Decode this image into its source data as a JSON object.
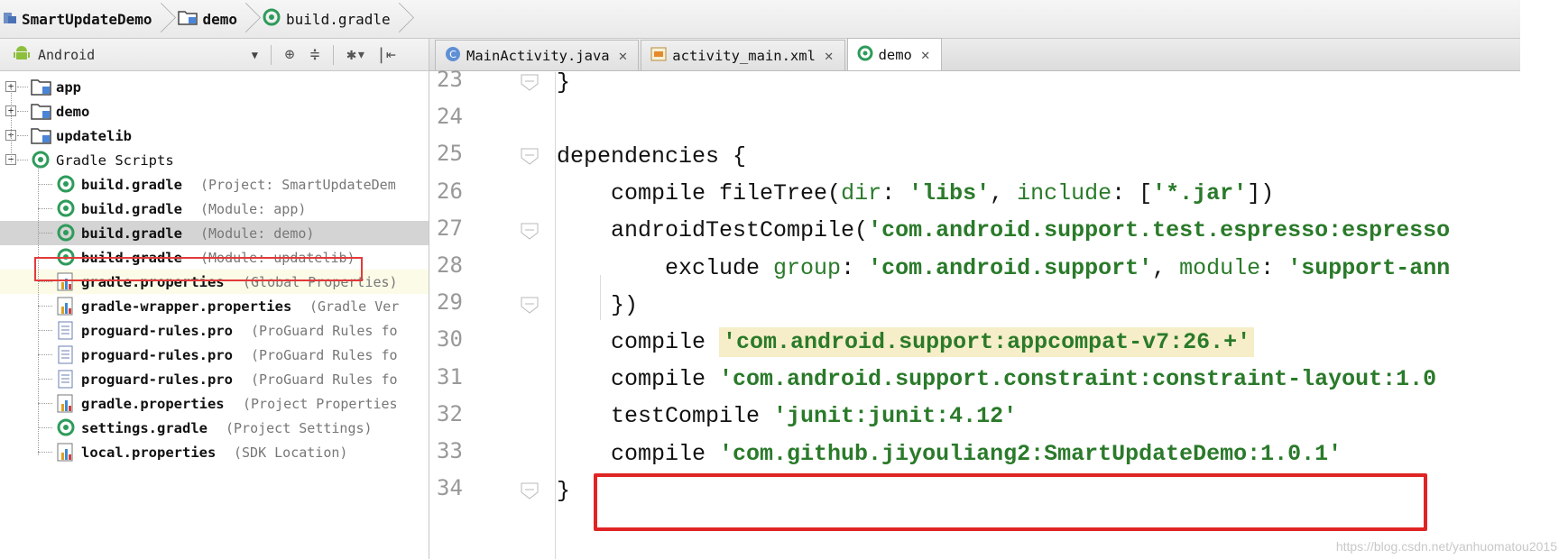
{
  "breadcrumb": [
    {
      "label": "SmartUpdateDemo",
      "icon": "project-module-icon"
    },
    {
      "label": "demo",
      "icon": "folder-module-icon"
    },
    {
      "label": "build.gradle",
      "icon": "gradle-icon"
    }
  ],
  "project_panel": {
    "view_mode": "Android",
    "tree": [
      {
        "label": "app",
        "hint": "",
        "type": "module",
        "bold": true
      },
      {
        "label": "demo",
        "hint": "",
        "type": "module",
        "bold": true
      },
      {
        "label": "updatelib",
        "hint": "",
        "type": "module",
        "bold": true
      },
      {
        "label": "Gradle Scripts",
        "hint": "",
        "type": "gradle-root",
        "bold": false
      },
      {
        "label": "build.gradle",
        "hint": "(Project: SmartUpdateDem",
        "type": "gradle"
      },
      {
        "label": "build.gradle",
        "hint": "(Module: app)",
        "type": "gradle"
      },
      {
        "label": "build.gradle",
        "hint": "(Module: demo)",
        "type": "gradle"
      },
      {
        "label": "build.gradle",
        "hint": "(Module: updatelib)",
        "type": "gradle"
      },
      {
        "label": "gradle.properties",
        "hint": "(Global Properties)",
        "type": "properties"
      },
      {
        "label": "gradle-wrapper.properties",
        "hint": "(Gradle Ver",
        "type": "properties"
      },
      {
        "label": "proguard-rules.pro",
        "hint": "(ProGuard Rules fo",
        "type": "text"
      },
      {
        "label": "proguard-rules.pro",
        "hint": "(ProGuard Rules fo",
        "type": "text"
      },
      {
        "label": "proguard-rules.pro",
        "hint": "(ProGuard Rules fo",
        "type": "text"
      },
      {
        "label": "gradle.properties",
        "hint": "(Project Properties",
        "type": "properties"
      },
      {
        "label": "settings.gradle",
        "hint": "(Project Settings)",
        "type": "gradle"
      },
      {
        "label": "local.properties",
        "hint": "(SDK Location)",
        "type": "properties"
      }
    ]
  },
  "tabs": [
    {
      "label": "MainActivity.java",
      "icon": "java-class-icon",
      "active": false
    },
    {
      "label": "activity_main.xml",
      "icon": "xml-layout-icon",
      "active": false
    },
    {
      "label": "demo",
      "icon": "gradle-icon",
      "active": true
    }
  ],
  "editor": {
    "lines": [
      {
        "no": "23",
        "parts": [
          {
            "t": "}",
            "c": ""
          }
        ]
      },
      {
        "no": "24",
        "parts": []
      },
      {
        "no": "25",
        "parts": [
          {
            "t": "dependencies {",
            "c": ""
          }
        ]
      },
      {
        "no": "26",
        "parts": [
          {
            "t": "    compile fileTree(",
            "c": ""
          },
          {
            "t": "dir",
            "c": "prop"
          },
          {
            "t": ": ",
            "c": ""
          },
          {
            "t": "'libs'",
            "c": "str"
          },
          {
            "t": ", ",
            "c": ""
          },
          {
            "t": "include",
            "c": "prop"
          },
          {
            "t": ": [",
            "c": ""
          },
          {
            "t": "'*.jar'",
            "c": "str"
          },
          {
            "t": "])",
            "c": ""
          }
        ]
      },
      {
        "no": "27",
        "parts": [
          {
            "t": "    androidTestCompile(",
            "c": ""
          },
          {
            "t": "'com.android.support.test.espresso:espresso",
            "c": "str"
          }
        ]
      },
      {
        "no": "28",
        "parts": [
          {
            "t": "        exclude ",
            "c": ""
          },
          {
            "t": "group",
            "c": "prop"
          },
          {
            "t": ": ",
            "c": ""
          },
          {
            "t": "'com.android.support'",
            "c": "str"
          },
          {
            "t": ", ",
            "c": ""
          },
          {
            "t": "module",
            "c": "prop"
          },
          {
            "t": ": ",
            "c": ""
          },
          {
            "t": "'support-ann",
            "c": "str"
          }
        ]
      },
      {
        "no": "29",
        "parts": [
          {
            "t": "    })",
            "c": ""
          }
        ]
      },
      {
        "no": "30",
        "parts": [
          {
            "t": "    compile ",
            "c": ""
          },
          {
            "t": "'com.android.support:appcompat-v7:26.+'",
            "c": "str-hl"
          }
        ]
      },
      {
        "no": "31",
        "parts": [
          {
            "t": "    compile ",
            "c": ""
          },
          {
            "t": "'com.android.support.constraint:constraint-layout:1.0",
            "c": "str"
          }
        ]
      },
      {
        "no": "32",
        "parts": [
          {
            "t": "    testCompile ",
            "c": ""
          },
          {
            "t": "'junit:junit:4.12'",
            "c": "str"
          }
        ]
      },
      {
        "no": "33",
        "parts": [
          {
            "t": "    compile ",
            "c": ""
          },
          {
            "t": "'com.github.jiyouliang2:SmartUpdateDemo:1.0.1'",
            "c": "str"
          }
        ]
      },
      {
        "no": "34",
        "parts": [
          {
            "t": "}",
            "c": ""
          }
        ]
      }
    ]
  },
  "watermark": "https://blog.csdn.net/yanhuomatou2015",
  "colors": {
    "string": "#2a7a2a",
    "highlight": "#f6eec8",
    "annotation_red": "#e02424",
    "selection": "#d4d4d4"
  }
}
